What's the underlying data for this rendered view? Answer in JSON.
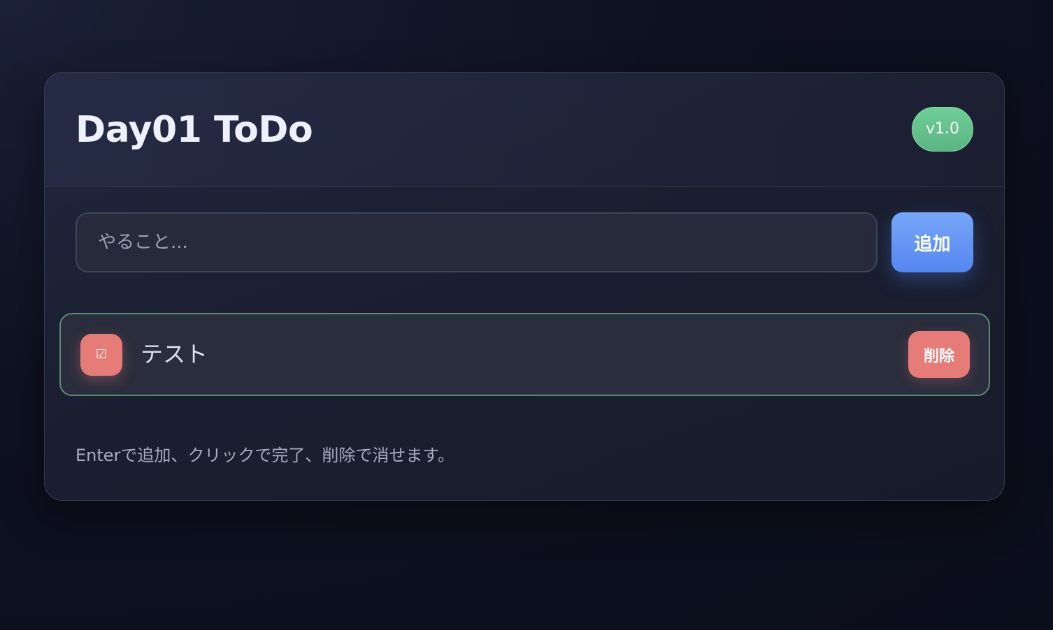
{
  "app": {
    "title": "Day01 ToDo",
    "version": "v1.0"
  },
  "input": {
    "placeholder": "やること...",
    "value": ""
  },
  "add_button": {
    "label": "追加"
  },
  "todos": [
    {
      "check_icon": "☑",
      "text": "テスト",
      "delete_label": "削除"
    }
  ],
  "hint": "Enterで追加、クリックで完了、削除で消せます。",
  "colors": {
    "accent_blue": "#5586f0",
    "badge_green": "#5bb584",
    "danger_red": "#e67c78",
    "item_border_green": "#5d8a72",
    "background": "#0e1120"
  },
  "icons": {
    "check": "checkbox-icon"
  }
}
